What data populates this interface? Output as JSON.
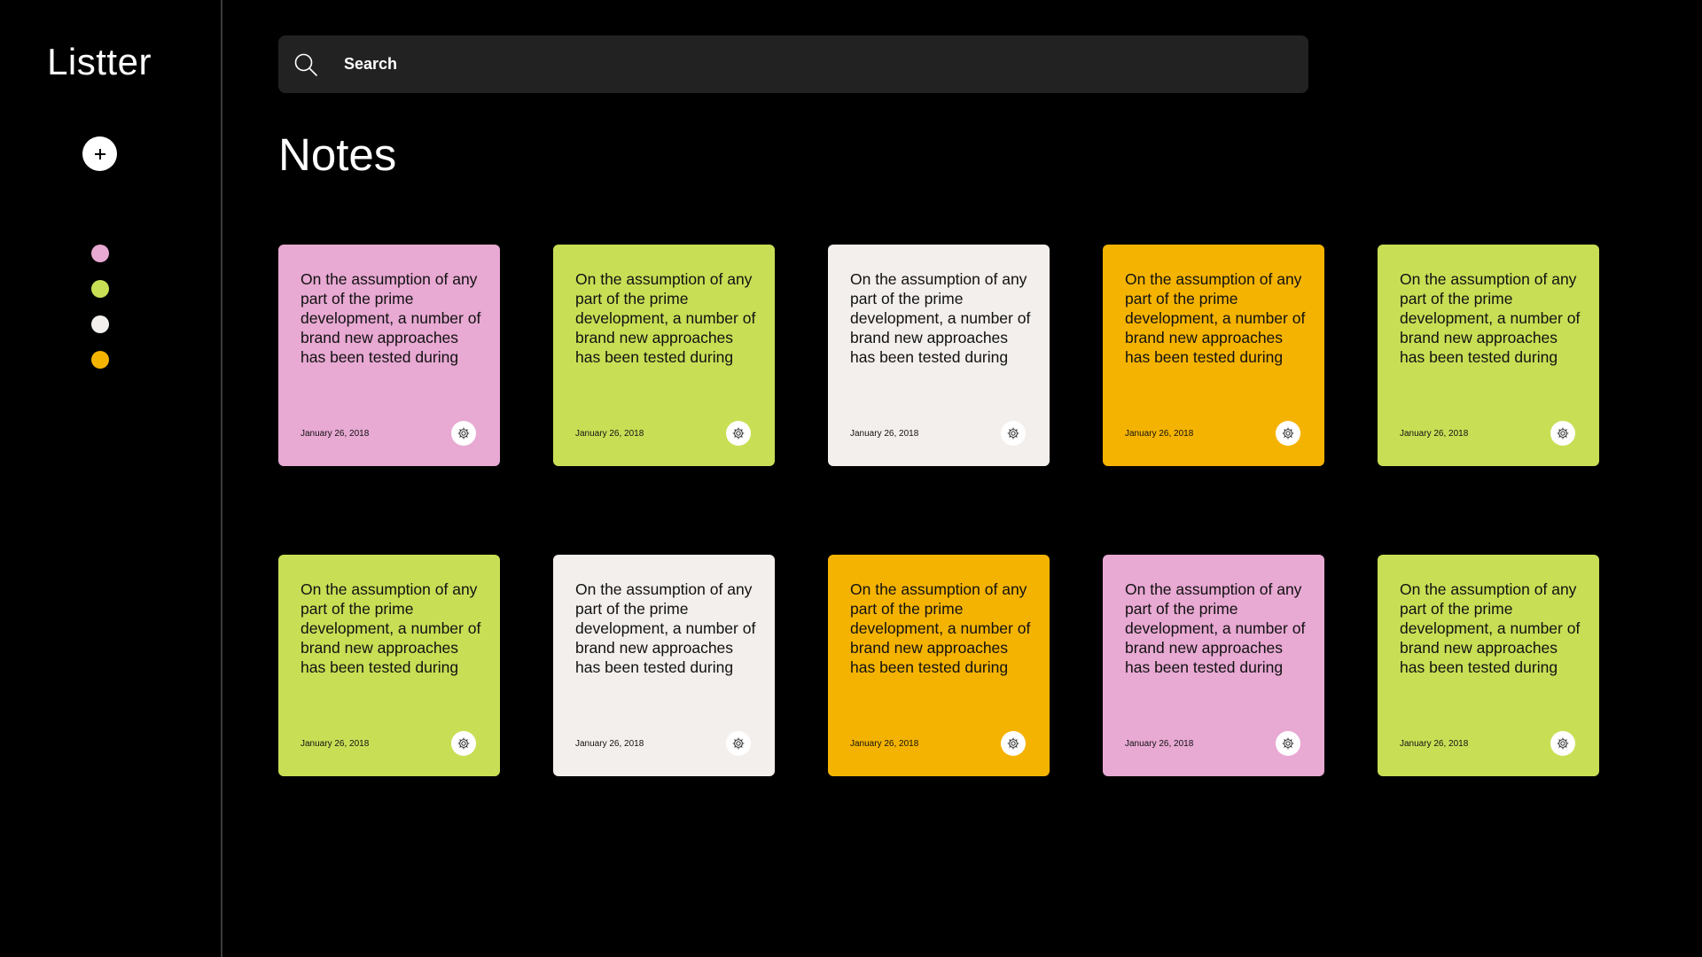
{
  "app": {
    "title": "Listter"
  },
  "sidebar": {
    "add_icon": "plus-icon",
    "colors": [
      {
        "name": "pink",
        "hex": "#E8A9D3"
      },
      {
        "name": "lime",
        "hex": "#C8DF55"
      },
      {
        "name": "white",
        "hex": "#F3EFEC"
      },
      {
        "name": "orange",
        "hex": "#F5B301"
      }
    ]
  },
  "search": {
    "placeholder": "Search",
    "icon": "search-icon"
  },
  "main": {
    "title": "Notes"
  },
  "notes": [
    {
      "text": "On the assumption of any part of the prime development, a number of brand new approaches has been tested during",
      "date": "January 26, 2018",
      "color": "#E8A9D3"
    },
    {
      "text": "On the assumption of any part of the prime development, a number of brand new approaches has been tested during",
      "date": "January 26, 2018",
      "color": "#C8DF55"
    },
    {
      "text": "On the assumption of any part of the prime development, a number of brand new approaches has been tested during",
      "date": "January 26, 2018",
      "color": "#F3EFEC"
    },
    {
      "text": "On the assumption of any part of the prime development, a number of brand new approaches has been tested during",
      "date": "January 26, 2018",
      "color": "#F5B301"
    },
    {
      "text": "On the assumption of any part of the prime development, a number of brand new approaches has been tested during",
      "date": "January 26, 2018",
      "color": "#C8DF55"
    },
    {
      "text": "On the assumption of any part of the prime development, a number of brand new approaches has been tested during",
      "date": "January 26, 2018",
      "color": "#C8DF55"
    },
    {
      "text": "On the assumption of any part of the prime development, a number of brand new approaches has been tested during",
      "date": "January 26, 2018",
      "color": "#F3EFEC"
    },
    {
      "text": "On the assumption of any part of the prime development, a number of brand new approaches has been tested during",
      "date": "January 26, 2018",
      "color": "#F5B301"
    },
    {
      "text": "On the assumption of any part of the prime development, a number of brand new approaches has been tested during",
      "date": "January 26, 2018",
      "color": "#E8A9D3"
    },
    {
      "text": "On the assumption of any part of the prime development, a number of brand new approaches has been tested during",
      "date": "January 26, 2018",
      "color": "#C8DF55"
    }
  ]
}
